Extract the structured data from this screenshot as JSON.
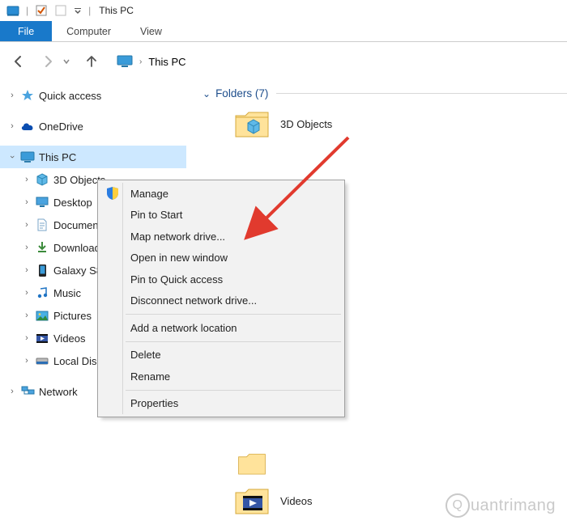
{
  "titlebar": {
    "title": "This PC"
  },
  "ribbon": {
    "file": "File",
    "tabs": [
      "Computer",
      "View"
    ]
  },
  "nav": {
    "location": "This PC"
  },
  "sidebar": {
    "quick_access": "Quick access",
    "onedrive": "OneDrive",
    "this_pc": "This PC",
    "children": [
      "3D Objects",
      "Desktop",
      "Documents",
      "Downloads",
      "Galaxy S8",
      "Music",
      "Pictures",
      "Videos",
      "Local Disk"
    ],
    "network": "Network"
  },
  "content": {
    "folders_header": "Folders (7)",
    "items": [
      {
        "name": "3D Objects",
        "icon": "3d"
      },
      {
        "name": "Videos",
        "icon": "videos"
      }
    ]
  },
  "context": {
    "items": [
      {
        "label": "Manage",
        "icon": "shield"
      },
      {
        "label": "Pin to Start"
      },
      {
        "label": "Map network drive..."
      },
      {
        "label": "Open in new window"
      },
      {
        "label": "Pin to Quick access"
      },
      {
        "label": "Disconnect network drive..."
      },
      "---",
      {
        "label": "Add a network location"
      },
      "---",
      {
        "label": "Delete"
      },
      {
        "label": "Rename"
      },
      "---",
      {
        "label": "Properties"
      }
    ]
  },
  "watermark": "uantrimang"
}
